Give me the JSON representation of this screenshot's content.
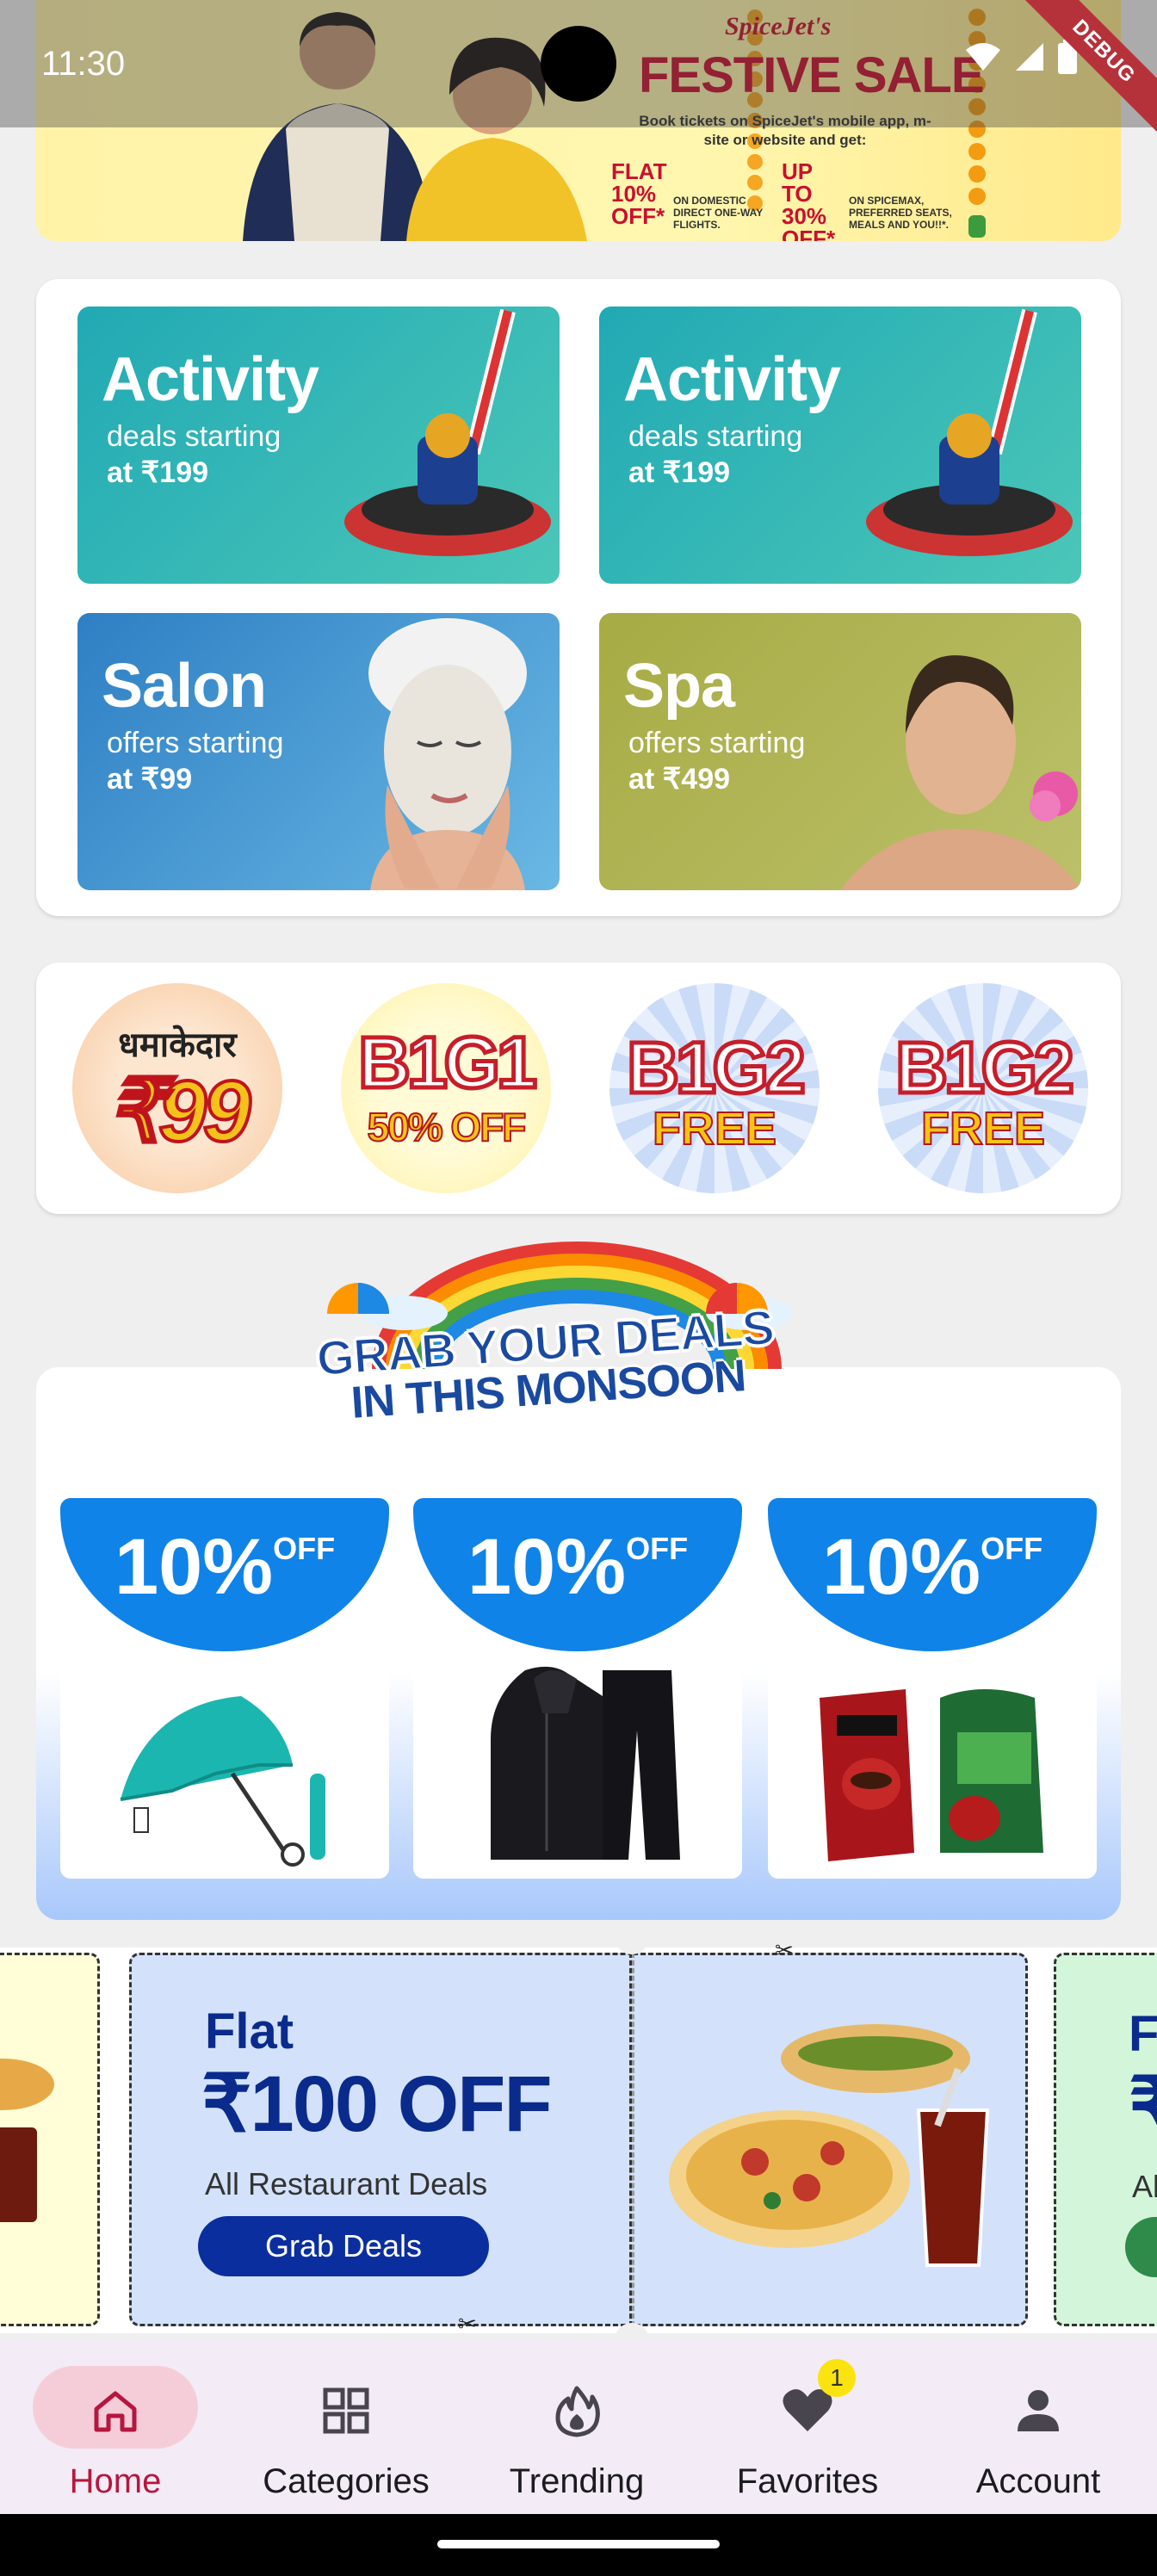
{
  "status_bar": {
    "time": "11:30",
    "debug_label": "DEBUG"
  },
  "top_banner": {
    "brand": "SpiceJet's",
    "headline": "FESTIVE SALE",
    "subtitle": "Book tickets on SpiceJet's mobile app, m-site or website and get:",
    "offer1_value": "FLAT 10% OFF*",
    "offer1_text": "ON DOMESTIC DIRECT ONE-WAY FLIGHTS.",
    "offer2_value": "UP TO 30% OFF*",
    "offer2_text": "ON SPICEMAX, PREFERRED SEATS, MEALS AND YOU!!*."
  },
  "service_tiles": [
    {
      "title": "Activity",
      "line1": "deals starting",
      "line2": "at ₹199",
      "bg": "#2fb5b3"
    },
    {
      "title": "Activity",
      "line1": "deals starting",
      "line2": "at ₹199",
      "bg": "#2fb5b3"
    },
    {
      "title": "Salon",
      "line1": "offers starting",
      "line2": "at ₹99",
      "bg": "#3d8fd1"
    },
    {
      "title": "Spa",
      "line1": "offers starting",
      "line2": "at ₹499",
      "bg": "#a9ad48"
    }
  ],
  "offer_circles": [
    {
      "top": "धमाकेदार",
      "main": "₹99"
    },
    {
      "top": "B1G1",
      "main": "50% OFF"
    },
    {
      "top": "B1G2",
      "main": "FREE"
    },
    {
      "top": "B1G2",
      "main": "FREE"
    }
  ],
  "monsoon": {
    "heading_line1": "GRAB YOUR DEALS",
    "heading_line2": "IN THIS MONSOON",
    "deals": [
      {
        "percent": "10%",
        "suffix": "OFF",
        "product_icon": "umbrella-icon"
      },
      {
        "percent": "10%",
        "suffix": "OFF",
        "product_icon": "raincoat-icon"
      },
      {
        "percent": "10%",
        "suffix": "OFF",
        "product_icon": "coffee-pack-icon"
      }
    ]
  },
  "coupon": {
    "flat": "Flat",
    "amount": "₹100 OFF",
    "description": "All Restaurant Deals",
    "button": "Grab Deals",
    "next_flat": "F",
    "next_amount": "₹",
    "next_desc": "Al"
  },
  "bottom_nav": {
    "items": [
      {
        "label": "Home",
        "icon": "home-icon"
      },
      {
        "label": "Categories",
        "icon": "grid-icon"
      },
      {
        "label": "Trending",
        "icon": "flame-icon"
      },
      {
        "label": "Favorites",
        "icon": "heart-icon"
      },
      {
        "label": "Account",
        "icon": "person-icon"
      }
    ],
    "favorites_badge": "1",
    "active_color": "#b5173f"
  }
}
